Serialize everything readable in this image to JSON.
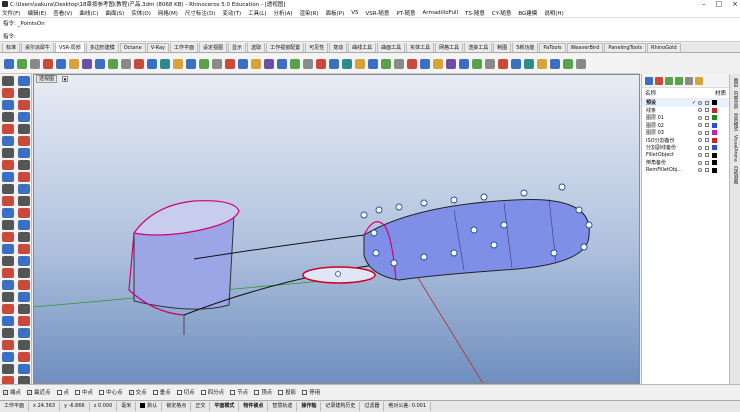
{
  "window": {
    "title": "C:\\Users\\sakura\\Desktop\\18章按参考图(教程)产品.3dm (8068 KB) - Rhinoceros 5.0 Education - [透视图]",
    "controls": [
      "–",
      "□",
      "×"
    ]
  },
  "menu": [
    "文件(F)",
    "编辑(E)",
    "查看(V)",
    "曲线(C)",
    "曲面(S)",
    "实体(O)",
    "网格(M)",
    "尺寸标注(D)",
    "变动(T)",
    "工具(L)",
    "分析(A)",
    "渲染(R)",
    "面板(P)",
    "V5",
    "VSR-随意",
    "PT-随意",
    "ArmadilloFull",
    "TS-随意",
    "CY-随意",
    "BG建模",
    "说明(H)"
  ],
  "command_history": "指令: _PointsOn",
  "command_prompt": "指令:",
  "toolbar_tabs": [
    "标准",
    "桌尔派犀牛",
    "VSR-局部",
    "多边形建模",
    "Octane",
    "V-Ray",
    "工作平面",
    "设定视图",
    "显示",
    "选取",
    "工作视窗配置",
    "可见性",
    "变动",
    "曲线工具",
    "曲面工具",
    "实体工具",
    "网格工具",
    "渲染工具",
    "制图",
    "5新功能",
    "PaTools",
    "WeaverBird",
    "PanelingTools",
    "RhinoGold"
  ],
  "active_tab": "VSR-局部",
  "toolbar_icon_colors": [
    "#3a6fc4",
    "#5aa34a",
    "#8a8a8a",
    "#c94a3a",
    "#3a6fc4",
    "#d8a23a",
    "#6b4fa8",
    "#3a6fc4",
    "#5aa34a",
    "#8a8a8a",
    "#c94a3a",
    "#3a6fc4",
    "#2e8b8b",
    "#d8a23a",
    "#3a6fc4",
    "#5aa34a",
    "#8a8a8a",
    "#c94a3a",
    "#3a6fc4",
    "#d8a23a",
    "#6b4fa8",
    "#3a6fc4",
    "#5aa34a",
    "#8a8a8a",
    "#c94a3a",
    "#3a6fc4",
    "#2e8b8b",
    "#d8a23a",
    "#3a6fc4",
    "#5aa34a",
    "#8a8a8a",
    "#c94a3a",
    "#3a6fc4",
    "#d8a23a",
    "#6b4fa8",
    "#3a6fc4",
    "#5aa34a",
    "#8a8a8a",
    "#c94a3a",
    "#3a6fc4",
    "#2e8b8b",
    "#d8a23a",
    "#3a6fc4",
    "#5aa34a",
    "#8a8a8a"
  ],
  "left_tool_colors": [
    "#555",
    "#3a6fc4",
    "#c94a3a",
    "#555",
    "#3a6fc4",
    "#c94a3a",
    "#555",
    "#3a6fc4",
    "#c94a3a",
    "#555",
    "#3a6fc4",
    "#c94a3a",
    "#555",
    "#3a6fc4",
    "#c94a3a",
    "#555",
    "#3a6fc4",
    "#c94a3a",
    "#555",
    "#3a6fc4",
    "#c94a3a",
    "#555",
    "#3a6fc4",
    "#c94a3a",
    "#555",
    "#3a6fc4",
    "#c94a3a",
    "#555",
    "#3a6fc4",
    "#c94a3a",
    "#555",
    "#3a6fc4",
    "#c94a3a",
    "#555",
    "#3a6fc4",
    "#c94a3a",
    "#555",
    "#3a6fc4",
    "#c94a3a",
    "#555",
    "#3a6fc4",
    "#c94a3a",
    "#555",
    "#3a6fc4",
    "#c94a3a",
    "#555",
    "#3a6fc4",
    "#c94a3a",
    "#555",
    "#3a6fc4",
    "#c94a3a",
    "#555"
  ],
  "viewport": {
    "label": "透视图",
    "menu_arrow": "▼"
  },
  "layers": {
    "header_name": "名称",
    "header_material": "材质",
    "rows": [
      {
        "name": "预设",
        "current": true,
        "check": "✓",
        "color": "#000000"
      },
      {
        "name": "线条",
        "current": false,
        "check": "",
        "color": "#cc2222"
      },
      {
        "name": "图层 01",
        "current": false,
        "check": "",
        "color": "#1a8a1a"
      },
      {
        "name": "图层 02",
        "current": false,
        "check": "",
        "color": "#2a4fd0"
      },
      {
        "name": "图层 03",
        "current": false,
        "check": "",
        "color": "#c020c0"
      },
      {
        "name": "ISO分割备份",
        "current": false,
        "check": "",
        "color": "#cc2222"
      },
      {
        "name": "分割副线备份",
        "current": false,
        "check": "",
        "color": "#2a4fd0"
      },
      {
        "name": "FilletObject",
        "current": false,
        "check": "",
        "color": "#000000"
      },
      {
        "name": "倒角备份",
        "current": false,
        "check": "",
        "color": "#000000"
      },
      {
        "name": "RemFilletObj...",
        "current": false,
        "check": "",
        "color": "#000000"
      }
    ]
  },
  "side_tabs": [
    "图层",
    "内容显示",
    "显示模式",
    "VisualArena",
    "自动测图"
  ],
  "osnaps": [
    {
      "label": "端点",
      "checked": true
    },
    {
      "label": "最近点",
      "checked": true
    },
    {
      "label": "点",
      "checked": false
    },
    {
      "label": "中点",
      "checked": false
    },
    {
      "label": "中心点",
      "checked": false
    },
    {
      "label": "交点",
      "checked": true
    },
    {
      "label": "垂点",
      "checked": false
    },
    {
      "label": "切点",
      "checked": false
    },
    {
      "label": "四分点",
      "checked": false
    },
    {
      "label": "节点",
      "checked": false
    },
    {
      "label": "顶点",
      "checked": false
    },
    {
      "label": "投影",
      "checked": false
    },
    {
      "label": "停用",
      "checked": false
    }
  ],
  "status": {
    "cplane": "工作平面",
    "x": "x 24.363",
    "y": "y -6.866",
    "z": "z 0.000",
    "unit": "毫米",
    "layer": "默认",
    "toggles": [
      "锁定格点",
      "正交",
      "平面模式",
      "物件锁点",
      "智慧轨迹",
      "操作轴",
      "记录建构历史",
      "过滤器"
    ],
    "bold_toggles": [
      "平面模式",
      "物件锁点",
      "操作轴"
    ],
    "tolerance": "绝对公差: 0.001"
  }
}
